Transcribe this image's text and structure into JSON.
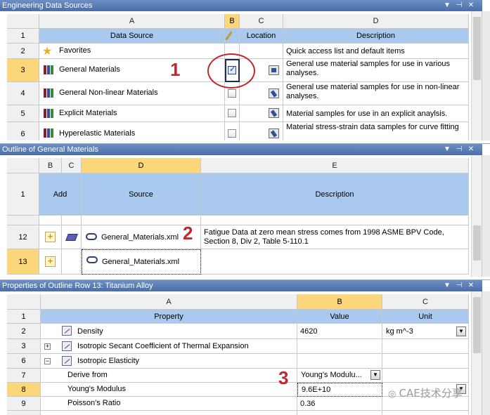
{
  "panel1": {
    "title": "Engineering Data Sources",
    "cols": [
      "A",
      "B",
      "C",
      "D"
    ],
    "header": {
      "source": "Data Source",
      "location": "Location",
      "description": "Description"
    },
    "rows": [
      {
        "num": "2",
        "name": "Favorites",
        "desc": "Quick access list and default items"
      },
      {
        "num": "3",
        "name": "General Materials",
        "desc": "General use material samples for use in various analyses."
      },
      {
        "num": "4",
        "name": "General Non-linear Materials",
        "desc": "General use material samples for use in non-linear analyses."
      },
      {
        "num": "5",
        "name": "Explicit Materials",
        "desc": "Material samples for use in an explicit anaylsis."
      },
      {
        "num": "6",
        "name": "Hyperelastic Materials",
        "desc": "Material stress-strain data samples for curve fitting"
      }
    ],
    "row1": "1"
  },
  "panel2": {
    "title": "Outline of General Materials",
    "cols": [
      "B",
      "C",
      "D",
      "E"
    ],
    "header": {
      "num": "1",
      "add": "Add",
      "source": "Source",
      "description": "Description"
    },
    "rows": [
      {
        "num": "12",
        "source": "General_Materials.xml",
        "desc": "Fatigue Data at zero mean stress comes from 1998 ASME BPV Code, Section 8, Div 2, Table 5-110.1"
      },
      {
        "num": "13",
        "source": "General_Materials.xml",
        "desc": ""
      }
    ]
  },
  "panel3": {
    "title": "Properties of Outline Row 13: Titanium Alloy",
    "cols": [
      "A",
      "B",
      "C"
    ],
    "header": {
      "num": "1",
      "property": "Property",
      "value": "Value",
      "unit": "Unit"
    },
    "rows": [
      {
        "num": "2",
        "property": "Density",
        "value": "4620",
        "unit": "kg m^-3"
      },
      {
        "num": "3",
        "property": "Isotropic Secant Coefficient of Thermal Expansion",
        "value": "",
        "unit": ""
      },
      {
        "num": "6",
        "property": "Isotropic Elasticity",
        "value": "",
        "unit": ""
      },
      {
        "num": "7",
        "property": "Derive from",
        "value": "Young's Modulu...",
        "unit": ""
      },
      {
        "num": "8",
        "property": "Young's Modulus",
        "value": "9.6E+10",
        "unit": ""
      },
      {
        "num": "9",
        "property": "Poisson's Ratio",
        "value": "0.36",
        "unit": ""
      }
    ]
  },
  "annotations": {
    "m1": "1",
    "m2": "2",
    "m3": "3"
  },
  "watermark": "CAE技术分享",
  "colors": {
    "title_bar": "#4a6ea9",
    "header_blue": "#a9c9ef",
    "selected": "#fbd67a",
    "marker": "#c0282d"
  }
}
